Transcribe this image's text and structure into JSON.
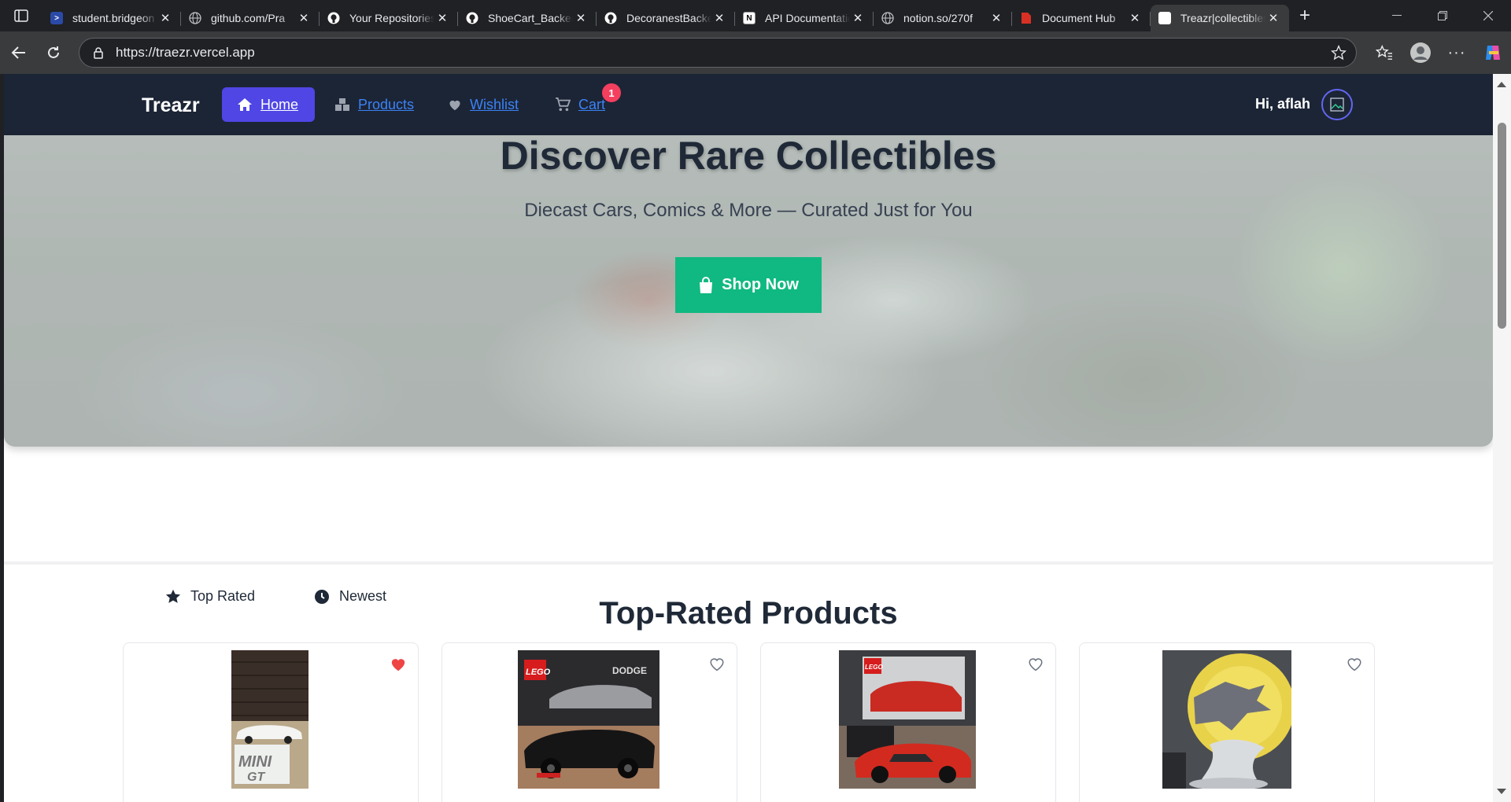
{
  "browser": {
    "tabs": [
      {
        "title": "student.bridgeon",
        "favicon": "bridgeon-icon",
        "color": "#2b4aa8"
      },
      {
        "title": "github.com/Pra",
        "favicon": "globe-icon",
        "color": "#5f6368"
      },
      {
        "title": "Your Repositories",
        "favicon": "github-icon",
        "color": "#ffffff"
      },
      {
        "title": "ShoeCart_Backend",
        "favicon": "github-icon",
        "color": "#ffffff"
      },
      {
        "title": "DecoranestBackend",
        "favicon": "github-icon",
        "color": "#ffffff"
      },
      {
        "title": "API Documentation",
        "favicon": "notion-icon",
        "color": "#ffffff"
      },
      {
        "title": "notion.so/270f",
        "favicon": "globe-icon",
        "color": "#5f6368"
      },
      {
        "title": "Document Hub",
        "favicon": "document-icon",
        "color": "#d93025"
      },
      {
        "title": "Treazr|collectibles",
        "favicon": "treazr-icon",
        "color": "#ffffff",
        "active": true
      }
    ],
    "url": "https://traezr.vercel.app"
  },
  "site": {
    "brand": "Treazr",
    "nav": {
      "home": "Home",
      "products": "Products",
      "wishlist": "Wishlist",
      "cart": "Cart",
      "cart_count": "1"
    },
    "greeting": "Hi, aflah",
    "colors": {
      "navbar": "#1c2536",
      "accent": "#4f46e5",
      "cta": "#10b981",
      "badge": "#f43f5e"
    }
  },
  "hero": {
    "title": "Discover Rare Collectibles",
    "subtitle": "Diecast Cars, Comics & More — Curated Just for You",
    "cta": "Shop Now"
  },
  "filters": {
    "top_rated": "Top Rated",
    "newest": "Newest"
  },
  "section": {
    "title": "Top-Rated Products"
  },
  "products": [
    {
      "image": "mini-gt-white-diecast-car",
      "wishlisted": true
    },
    {
      "image": "lego-dodge-challenger-black",
      "wishlisted": false
    },
    {
      "image": "lego-porsche-911-red",
      "wishlisted": false
    },
    {
      "image": "comic-figure-statue-yellow-moon",
      "wishlisted": false
    }
  ]
}
